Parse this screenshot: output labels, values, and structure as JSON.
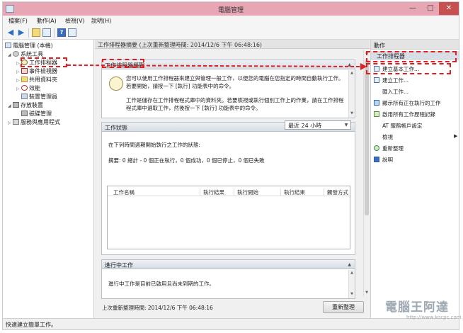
{
  "window": {
    "title": "電腦管理"
  },
  "menu": [
    "檔案(F)",
    "動作(A)",
    "檢視(V)",
    "說明(H)"
  ],
  "tree": {
    "root": "電腦管理 (本機)",
    "system_tools": "系統工具",
    "task_scheduler": "工作排程器",
    "event_viewer": "事件檢視器",
    "shared_folders": "共用資料夾",
    "performance": "效能",
    "device_manager": "裝置管理員",
    "storage": "存放裝置",
    "disk_management": "磁碟管理",
    "services": "服務與應用程式"
  },
  "center": {
    "header": "工作排程器摘要 (上次重新整理時間: 2014/12/6 下午 06:48:16)",
    "overview_title": "工作排程器概觀",
    "overview_p1": "您可以使用工作排程器來建立與管理一般工作，以便您的電腦在您指定的時間自動執行工作。若要開始，請按一下 [執行] 功能表中的命令。",
    "overview_p2": "工作是儲存在工作排程程式庫中的資料夾。若要檢視或執行個別工作上的作業，請在工作排程程式庫中選取工作，然後按一下 [執行] 功能表中的命令。",
    "status_title": "工作狀態",
    "status_prompt": "在下列時間週期開始執行之工作的狀態:",
    "period": "最近 24 小時",
    "summary": "摘要: 0 總計 - 0 個正在執行，0 個成功，0 個已停止，0 個已失敗",
    "columns": [
      "工作名稱",
      "執行結果",
      "執行開始",
      "執行結束",
      "觸發方式"
    ],
    "active_title": "進行中工作",
    "active_text": "進行中工作是目前已啟用且尚未到期的工作。",
    "last_refresh": "上次重新整理時間: 2014/12/6 下午 06:48:16",
    "refresh_button": "重新整理"
  },
  "actions": {
    "header": "動作",
    "subheader": "工作排程器",
    "create_basic": "建立基本工作...",
    "create_task": "建立工作...",
    "import_task": "匯入工作...",
    "show_running": "顯示所有正在執行的工作",
    "enable_history": "啟用所有工作歷程記錄",
    "at_account": "AT 服務帳戶設定",
    "view": "檢視",
    "refresh": "重新整理",
    "help": "說明"
  },
  "status_bar": "快速建立簡單工作。",
  "watermark": {
    "brand": "電腦王阿達",
    "url": "http://www.kocpc.com.tw"
  },
  "colors": {
    "titlebar": "#e8a6b4",
    "highlight": "#e02020",
    "close": "#c75050"
  }
}
